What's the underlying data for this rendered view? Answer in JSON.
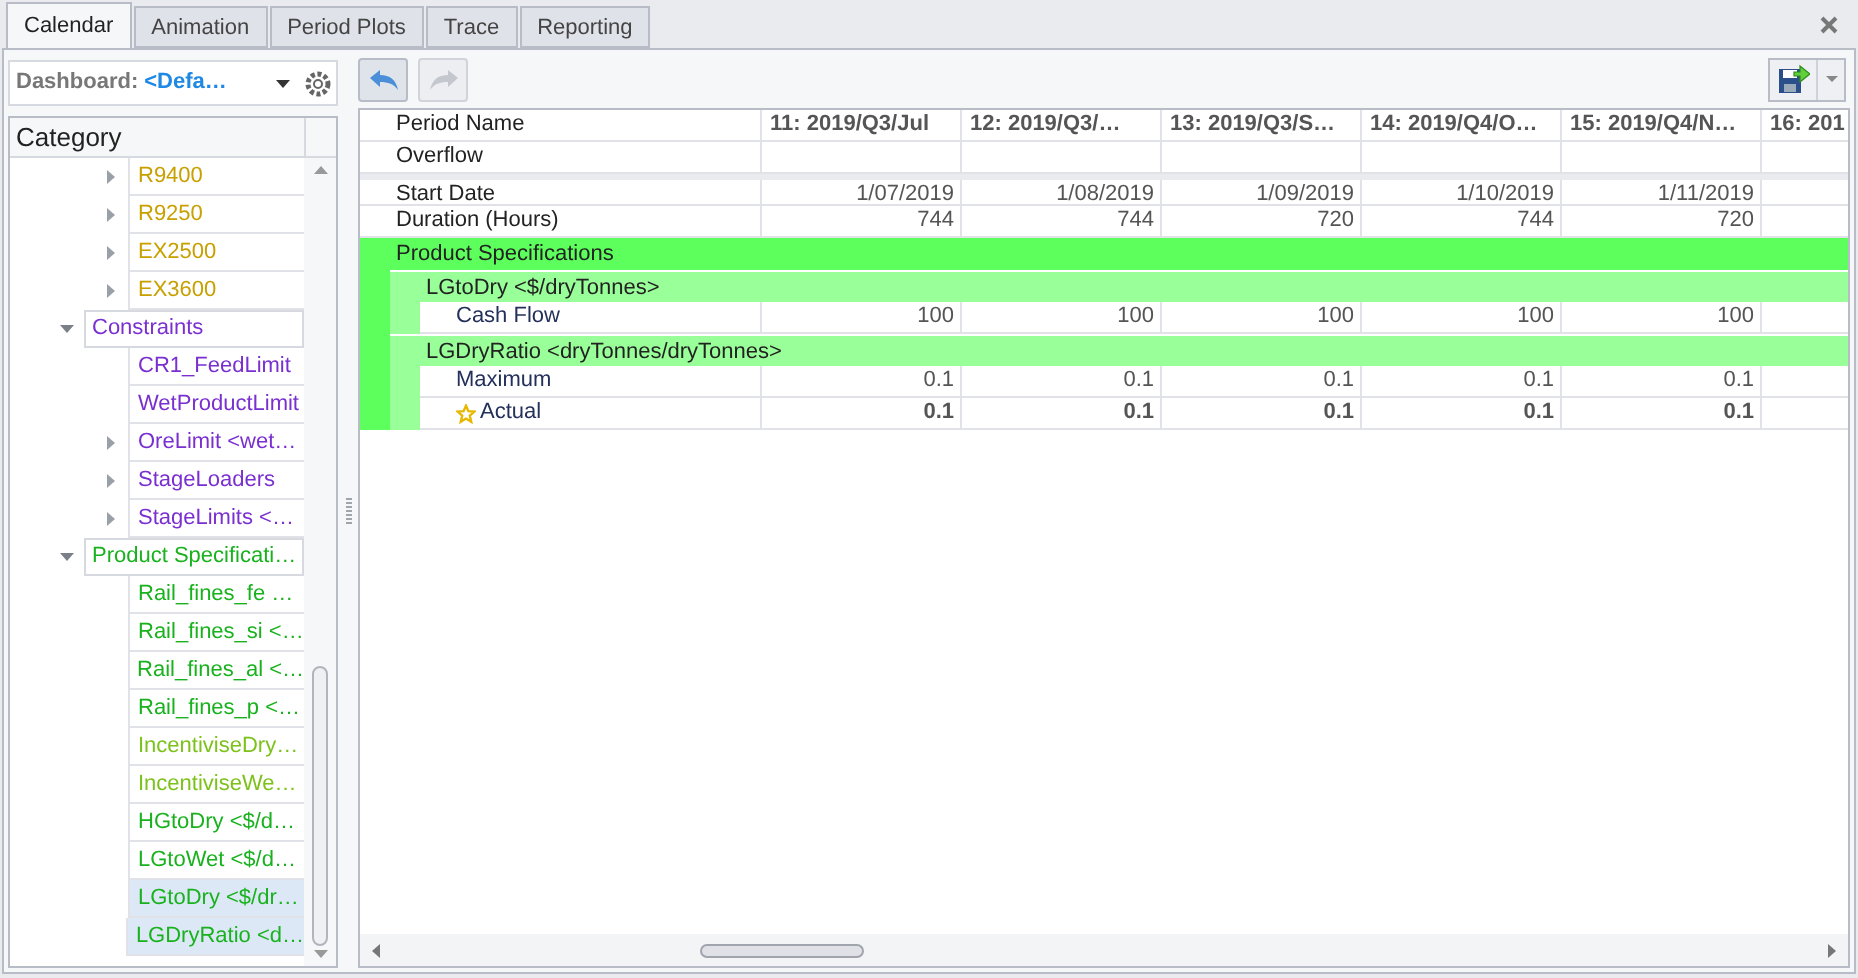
{
  "tabs": [
    {
      "label": "Calendar",
      "selected": true
    },
    {
      "label": "Animation",
      "selected": false
    },
    {
      "label": "Period Plots",
      "selected": false
    },
    {
      "label": "Trace",
      "selected": false
    },
    {
      "label": "Reporting",
      "selected": false
    }
  ],
  "dashboard": {
    "label": "Dashboard:",
    "value": "<Defa…"
  },
  "category_tree": {
    "header": "Category",
    "items": [
      {
        "kind": "continued",
        "children": [
          {
            "label": "R9400",
            "has_children": true,
            "color": "#c8a000",
            "selected": false
          },
          {
            "label": "R9250",
            "has_children": true,
            "color": "#c8a000",
            "selected": false
          },
          {
            "label": "EX2500",
            "has_children": true,
            "color": "#c8a000",
            "selected": false
          },
          {
            "label": "EX3600",
            "has_children": true,
            "color": "#c8a000",
            "selected": false
          }
        ]
      },
      {
        "kind": "group",
        "label": "Constraints",
        "color": "#7a2fd0",
        "expanded": true,
        "children": [
          {
            "label": "CR1_FeedLimit",
            "has_children": false,
            "color": "#7a2fd0",
            "selected": false
          },
          {
            "label": "WetProductLimit",
            "has_children": false,
            "color": "#7a2fd0",
            "selected": false
          },
          {
            "label": "OreLimit <wet…",
            "has_children": true,
            "color": "#7a2fd0",
            "selected": false
          },
          {
            "label": "StageLoaders",
            "has_children": true,
            "color": "#7a2fd0",
            "selected": false
          },
          {
            "label": "StageLimits <…",
            "has_children": true,
            "color": "#7a2fd0",
            "selected": false
          }
        ]
      },
      {
        "kind": "group",
        "label": "Product Specificati…",
        "color": "#19b21e",
        "expanded": true,
        "children": [
          {
            "label": "Rail_fines_fe …",
            "has_children": false,
            "color": "#19b21e",
            "selected": false
          },
          {
            "label": "Rail_fines_si <…",
            "has_children": false,
            "color": "#19b21e",
            "selected": false
          },
          {
            "label": "Rail_fines_al <…",
            "has_children": false,
            "color": "#19b21e",
            "selected": false
          },
          {
            "label": "Rail_fines_p <…",
            "has_children": false,
            "color": "#19b21e",
            "selected": false
          },
          {
            "label": "IncentiviseDry…",
            "has_children": false,
            "color": "#7cc21a",
            "selected": false
          },
          {
            "label": "IncentiviseWe…",
            "has_children": false,
            "color": "#7cc21a",
            "selected": false
          },
          {
            "label": "HGtoDry <$/d…",
            "has_children": false,
            "color": "#19b21e",
            "selected": false
          },
          {
            "label": "LGtoWet <$/d…",
            "has_children": false,
            "color": "#19b21e",
            "selected": false
          },
          {
            "label": "LGtoDry <$/dr…",
            "has_children": false,
            "color": "#19b21e",
            "selected": true
          },
          {
            "label": "LGDryRatio <d…",
            "has_children": false,
            "color": "#19b21e",
            "selected": true
          }
        ]
      }
    ]
  },
  "toolbar": {
    "undo_disabled": false,
    "redo_disabled": true
  },
  "grid": {
    "corner": "Period Name",
    "columns": [
      "11: 2019/Q3/Jul",
      "12: 2019/Q3/…",
      "13: 2019/Q3/S…",
      "14: 2019/Q4/O…",
      "15: 2019/Q4/N…",
      "16: 201"
    ],
    "info_rows": [
      {
        "label": "Overflow",
        "cells": []
      },
      {
        "label": "Start Date",
        "cells": [
          "1/07/2019",
          "1/08/2019",
          "1/09/2019",
          "1/10/2019",
          "1/11/2019"
        ],
        "separated": true
      },
      {
        "label": "Duration (Hours)",
        "cells": [
          "744",
          "744",
          "720",
          "744",
          "720"
        ],
        "separated": false
      }
    ],
    "groups": [
      {
        "label": "Product Specifications",
        "color": "#5cff5c",
        "children": [
          {
            "label": "LGtoDry <$/dryTonnes>",
            "color": "#99ff99",
            "children": [
              {
                "label": "Cash Flow",
                "cells": [
                  "100",
                  "100",
                  "100",
                  "100",
                  "100"
                ],
                "emphasized": false,
                "starred": false
              }
            ]
          },
          {
            "label": "LGDryRatio <dryTonnes/dryTonnes>",
            "color": "#99ff99",
            "children": [
              {
                "label": "Maximum",
                "cells": [
                  "0.1",
                  "0.1",
                  "0.1",
                  "0.1",
                  "0.1"
                ],
                "emphasized": false,
                "starred": false
              },
              {
                "label": "Actual",
                "cells": [
                  "0.1",
                  "0.1",
                  "0.1",
                  "0.1",
                  "0.1"
                ],
                "emphasized": true,
                "starred": true
              }
            ]
          }
        ]
      }
    ]
  }
}
